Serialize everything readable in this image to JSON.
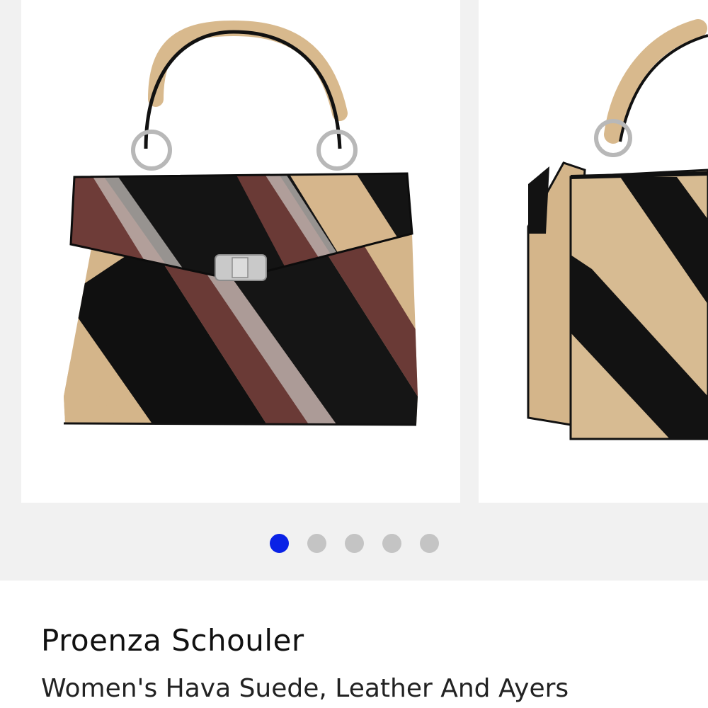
{
  "product": {
    "brand": "Proenza Schouler",
    "name": "Women's Hava Suede, Leather And Ayers"
  },
  "gallery": {
    "total_images": 5,
    "active_index": 0,
    "images": [
      {
        "icon": "handbag-front-view"
      },
      {
        "icon": "handbag-side-view"
      }
    ]
  },
  "colors": {
    "active_dot": "#0a22e6",
    "inactive_dot": "#c4c4c4",
    "page_background": "#f1f1f1"
  }
}
